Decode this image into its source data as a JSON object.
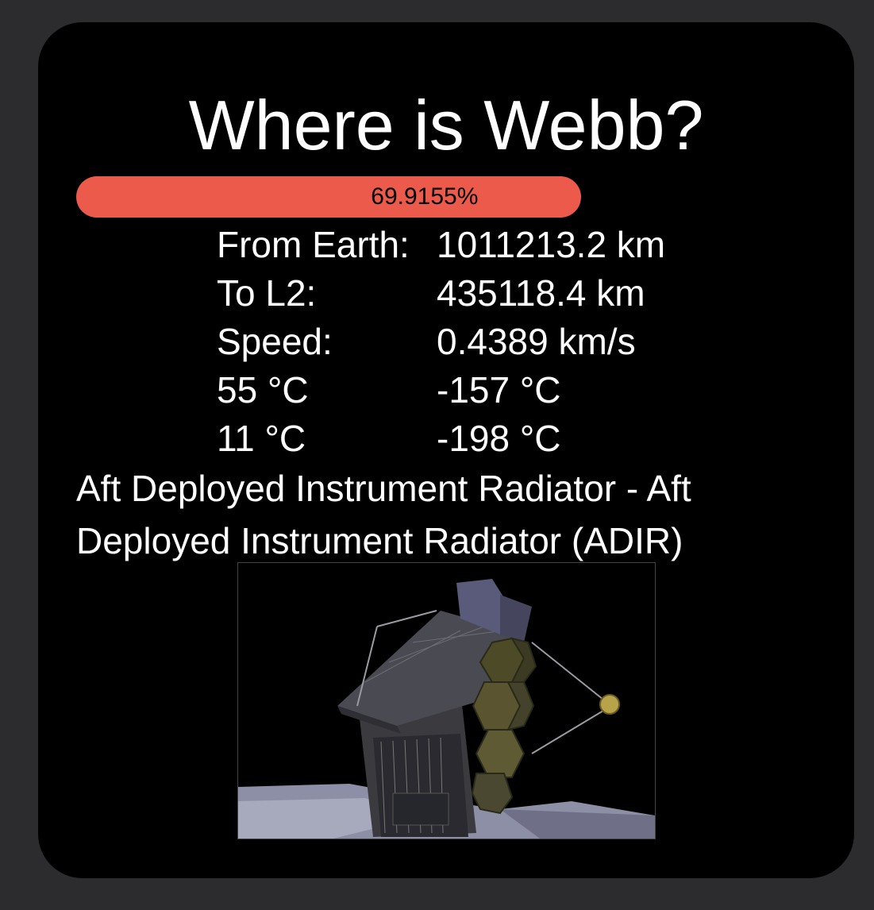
{
  "title": "Where is Webb?",
  "progress": {
    "percent": 69.9155,
    "label": "69.9155%",
    "color": "#eb5a4b"
  },
  "stats": [
    {
      "label": "From Earth:",
      "value": "1011213.2 km"
    },
    {
      "label": "To L2:",
      "value": "435118.4 km"
    },
    {
      "label": "Speed:",
      "value": "0.4389 km/s"
    },
    {
      "label": "55 °C",
      "value": "-157 °C"
    },
    {
      "label": "11 °C",
      "value": "-198 °C"
    }
  ],
  "description": "Aft Deployed Instrument Radiator - Aft Deployed Instrument Radiator (ADIR)"
}
